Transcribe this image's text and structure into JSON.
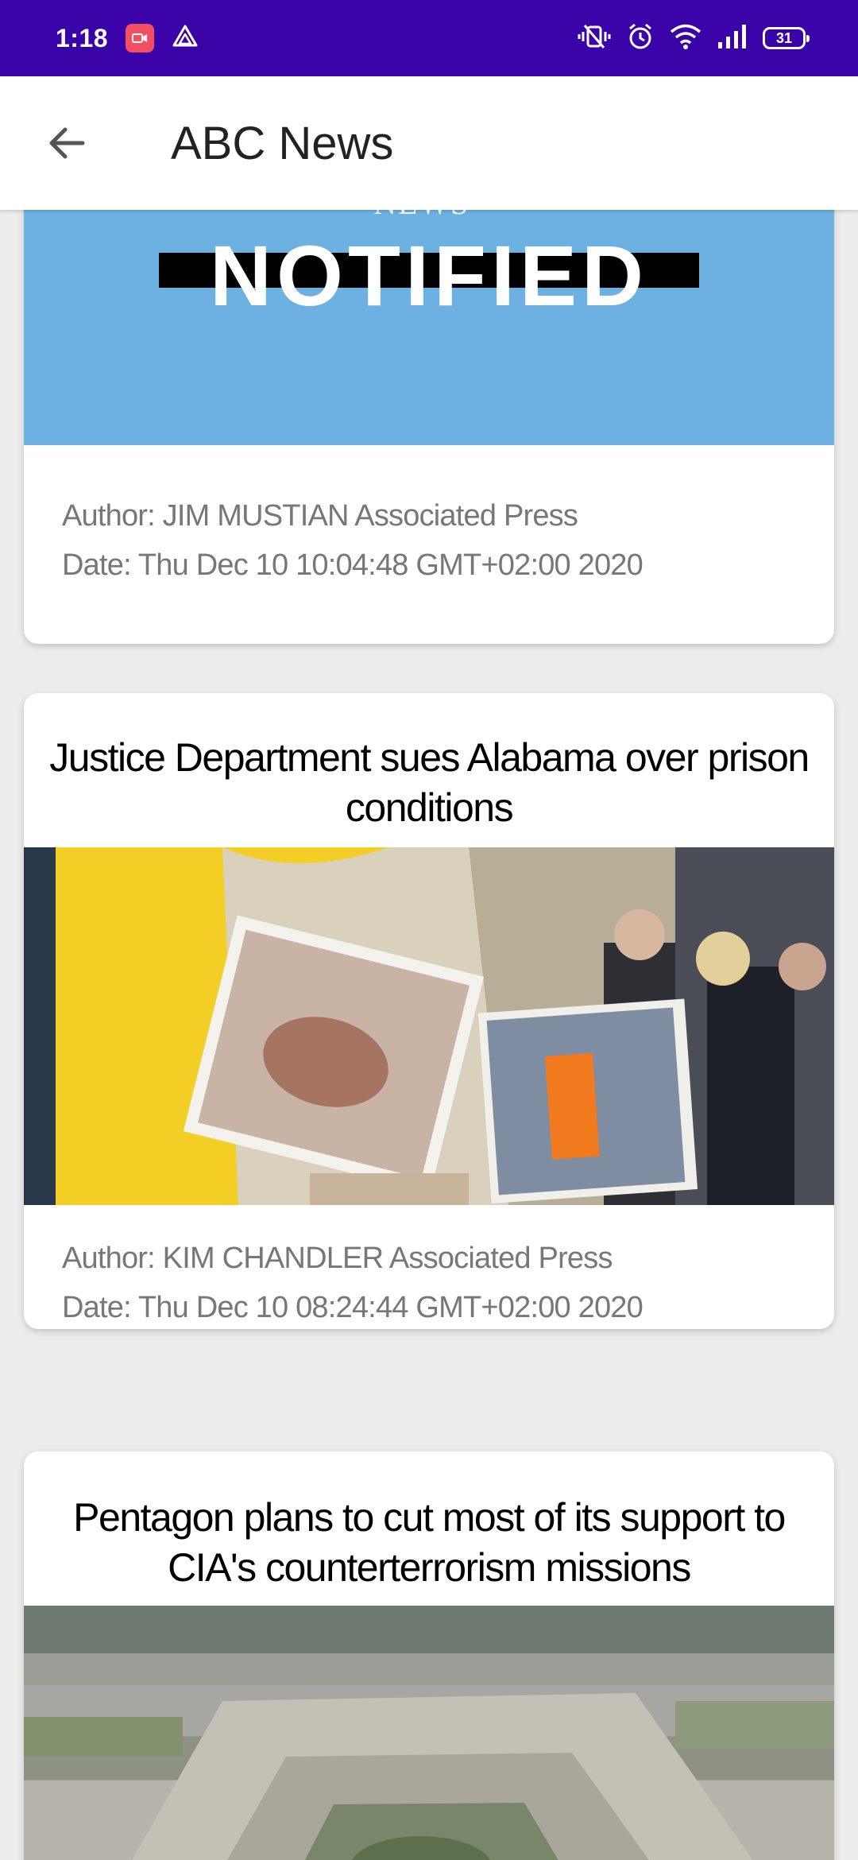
{
  "status_bar": {
    "time": "1:18",
    "battery": "31"
  },
  "app_bar": {
    "title": "ABC News"
  },
  "articles": [
    {
      "image_text": "NOTIFIED",
      "image_subtext": "NEWS",
      "author": "Author: JIM MUSTIAN Associated Press",
      "date": "Date: Thu Dec 10 10:04:48 GMT+02:00 2020"
    },
    {
      "title": "Justice Department sues Alabama over prison conditions",
      "author": "Author: KIM CHANDLER   Associated Press",
      "date": "Date: Thu Dec 10 08:24:44 GMT+02:00 2020"
    },
    {
      "title": "Pentagon plans to cut most of its support to CIA's counterterrorism missions"
    }
  ],
  "colors": {
    "status_bar": "#3a03a8",
    "app_bar": "#ffffff",
    "page_bg": "#ececec"
  }
}
